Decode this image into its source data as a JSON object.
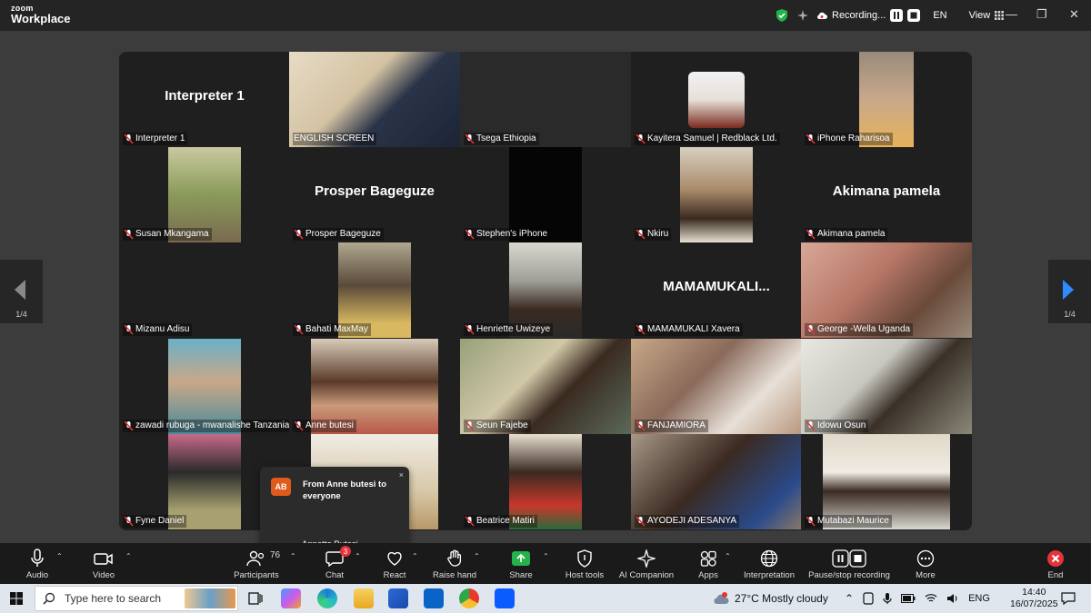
{
  "app": {
    "logo_top": "zoom",
    "logo_bottom": "Workplace"
  },
  "header": {
    "recording_label": "Recording...",
    "language": "EN",
    "view_label": "View"
  },
  "colors": {
    "active_speaker": "#2ad76d",
    "chat_badge": "#e5333a",
    "end_red": "#e5333a",
    "avatar": "#e05a1a"
  },
  "tiles": [
    {
      "name": "Interpreter 1",
      "big": "Interpreter 1"
    },
    {
      "name": "ENGLISH SCREEN",
      "active": true,
      "video": "wide"
    },
    {
      "name": "Tsega Ethiopia",
      "video": "wide-dark"
    },
    {
      "name": "Kayitera Samuel | Redblack Ltd.",
      "video": "logo"
    },
    {
      "name": "iPhone Raharisoa",
      "video": "narrow"
    },
    {
      "name": "Susan Mkangama",
      "video": "narrow"
    },
    {
      "name": "Prosper Bageguze",
      "big": "Prosper Bageguze"
    },
    {
      "name": "Stephen's iPhone",
      "video": "narrow-black"
    },
    {
      "name": "Nkiru",
      "video": "narrow"
    },
    {
      "name": "Akimana pamela",
      "big": "Akimana pamela"
    },
    {
      "name": "Mizanu Adisu"
    },
    {
      "name": "Bahati MaxMay",
      "video": "narrow"
    },
    {
      "name": "Henriette Uwizeye",
      "video": "narrow"
    },
    {
      "name": "MAMAMUKALI Xavera",
      "big": "MAMAMUKALI..."
    },
    {
      "name": "George -Wella Uganda",
      "video": "wide"
    },
    {
      "name": "zawadi rubuga - mwanalishe Tanzania",
      "video": "narrow"
    },
    {
      "name": "Anne butesi",
      "video": "mid"
    },
    {
      "name": "Seun Fajebe",
      "video": "wide"
    },
    {
      "name": "FANJAMIORA",
      "video": "wide"
    },
    {
      "name": "Idowu Osun",
      "video": "wide"
    },
    {
      "name": "Fyne  Daniel",
      "video": "narrow"
    },
    {
      "name": "",
      "video": "mid"
    },
    {
      "name": "Beatrice Matiri",
      "video": "narrow"
    },
    {
      "name": "AYODEJI ADESANYA",
      "video": "wide"
    },
    {
      "name": "Mutabazi Maurice",
      "video": "mid"
    }
  ],
  "pager": {
    "left": "1/4",
    "right": "1/4"
  },
  "chat_popup": {
    "initials": "AB",
    "header": "From Anne butesi to everyone",
    "message": "Annette Butesi",
    "close": "×"
  },
  "toolbar": {
    "audio": "Audio",
    "video": "Video",
    "participants": "Participants",
    "participants_count": "76",
    "chat": "Chat",
    "chat_badge": "3",
    "react": "React",
    "raise_hand": "Raise hand",
    "share": "Share",
    "host_tools": "Host tools",
    "ai_companion": "AI Companion",
    "apps": "Apps",
    "interpretation": "Interpretation",
    "pause_recording": "Pause/stop recording",
    "more": "More",
    "end": "End"
  },
  "taskbar": {
    "search_placeholder": "Type here to search",
    "weather": "27°C  Mostly cloudy",
    "lang": "ENG",
    "time": "14:40",
    "date": "16/07/2025"
  }
}
